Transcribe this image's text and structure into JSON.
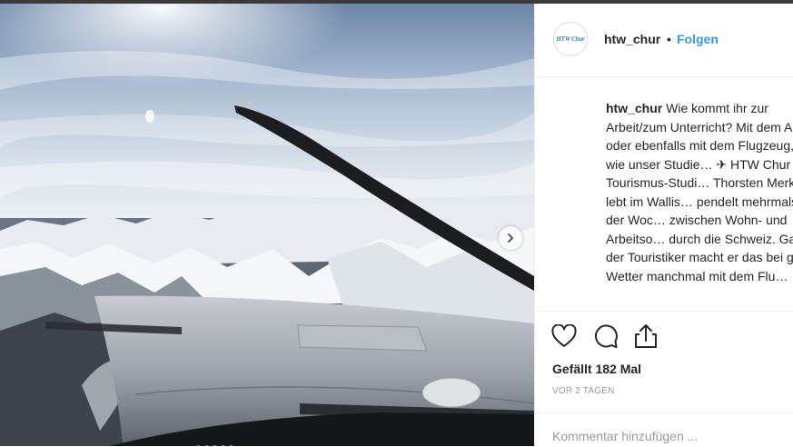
{
  "post": {
    "username": "htw_chur",
    "separator": "•",
    "follow_label": "Folgen",
    "avatar_text": "HTW Chur",
    "caption_user": "htw_chur",
    "caption_text": " Wie kommt ihr zur Arbeit/zum Unterricht? Mit dem Auto oder ebenfalls mit dem Flugzeug, so wie unser Studie… ✈ HTW Chur Tourismus-Studi… Thorsten Merkle lebt im Wallis… pendelt mehrmals in der Woc… zwischen Wohn- und Arbeitso… durch die Schweiz. Ganz der Touristiker macht er das bei g… Wetter manchmal mit dem Flu…",
    "likes": "Gefällt 182 Mal",
    "date": "VOR 2 TAGEN",
    "comment_placeholder": "Kommentar hinzufügen ..."
  },
  "icons": {
    "like": "heart-icon",
    "comment": "comment-icon",
    "share": "share-icon",
    "next": "chevron-right-icon"
  },
  "colors": {
    "follow": "#3897f0",
    "text": "#262626",
    "muted": "#999999",
    "border": "#efefef"
  }
}
